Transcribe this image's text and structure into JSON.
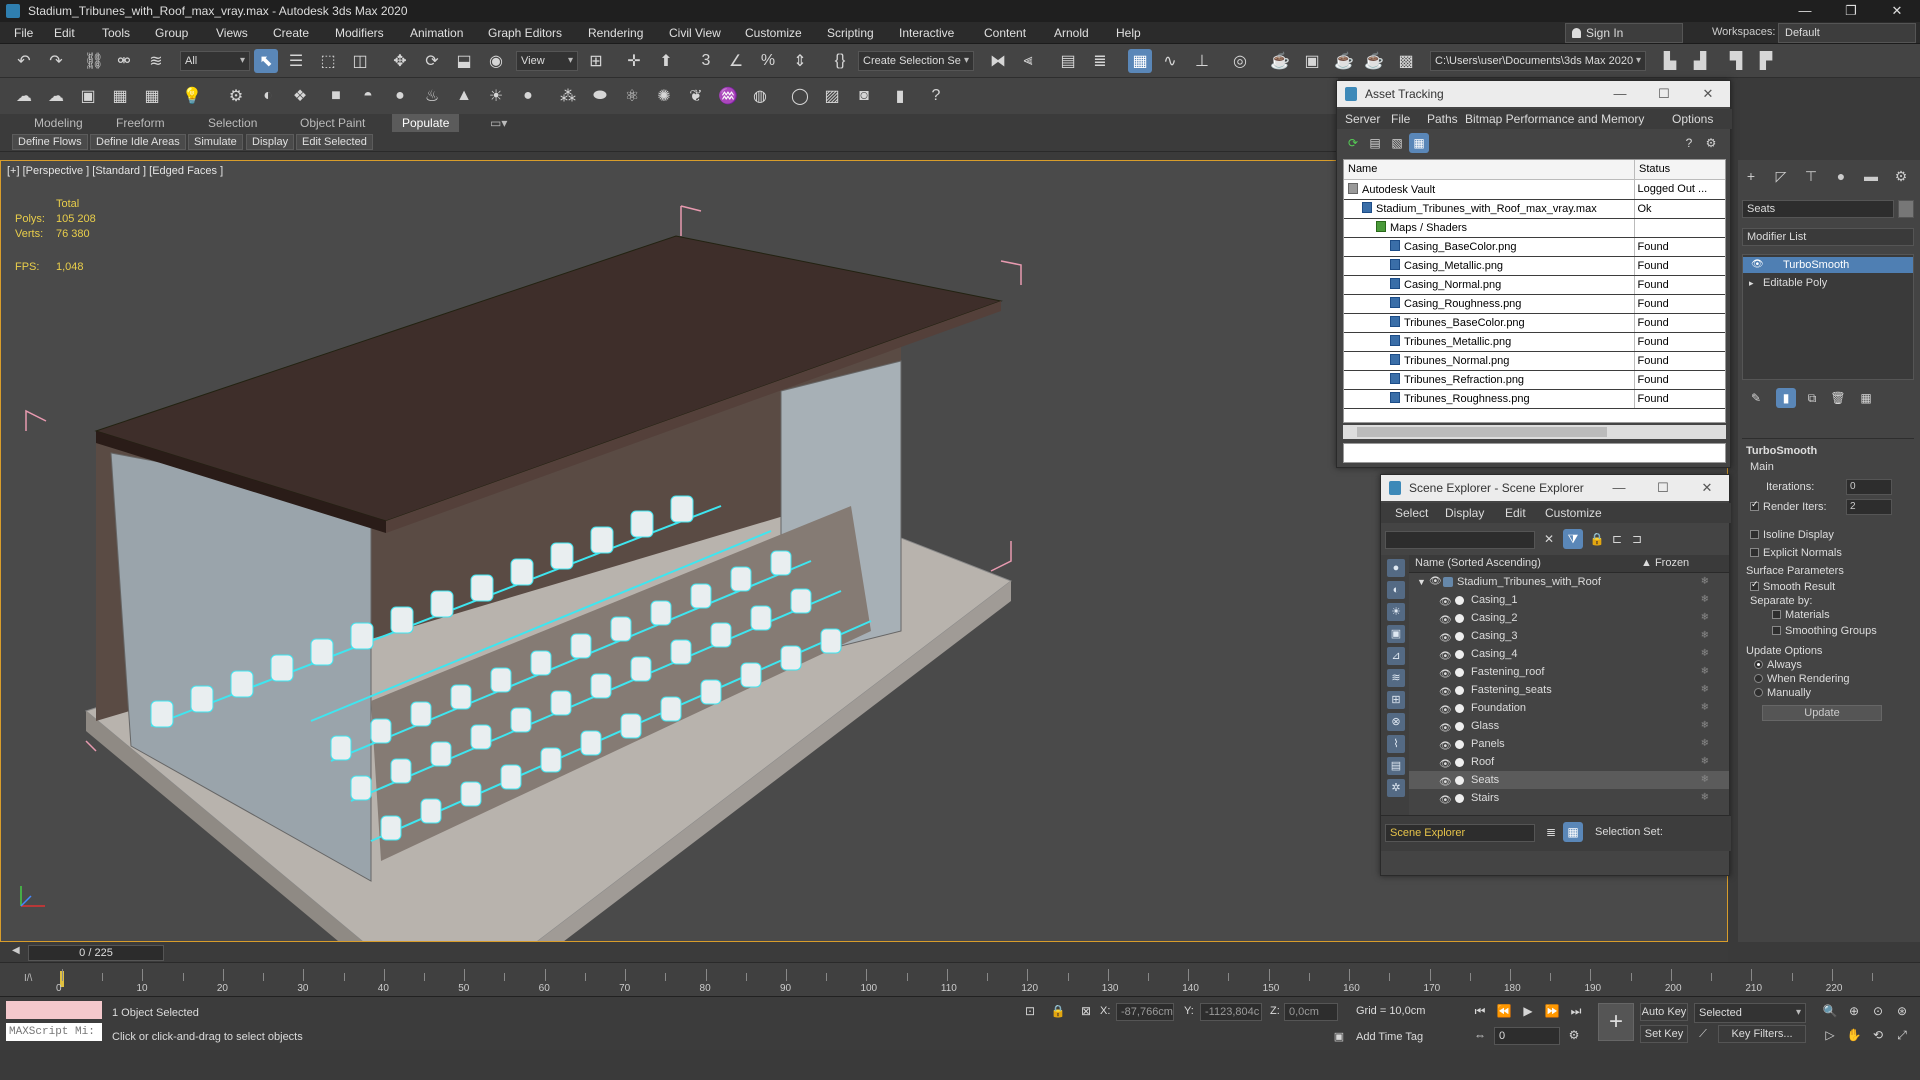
{
  "window": {
    "title": "Stadium_Tribunes_with_Roof_max_vray.max - Autodesk 3ds Max 2020",
    "minimize": "—",
    "maximize": "❐",
    "close": "✕"
  },
  "menubar": [
    "File",
    "Edit",
    "Tools",
    "Group",
    "Views",
    "Create",
    "Modifiers",
    "Animation",
    "Graph Editors",
    "Rendering",
    "Civil View",
    "Customize",
    "Scripting",
    "Interactive",
    "Content",
    "Arnold",
    "Help"
  ],
  "account": {
    "sign_in": "Sign In",
    "workspaces_label": "Workspaces:",
    "workspace": "Default"
  },
  "toolbar": {
    "selection_filter": "All",
    "ref_coord": "View",
    "named_selection": "Create Selection Se",
    "project_path": "C:\\Users\\user\\Documents\\3ds Max 2020"
  },
  "ribbon": {
    "tabs": [
      "Modeling",
      "Freeform",
      "Selection",
      "Object Paint",
      "Populate"
    ],
    "active_tab": "Populate",
    "populate_buttons": [
      "Define Flows",
      "Define Idle Areas",
      "Simulate",
      "Display",
      "Edit Selected"
    ]
  },
  "viewport": {
    "label": "[+] [Perspective ] [Standard ] [Edged Faces ]",
    "stats": {
      "total_label": "Total",
      "polys_label": "Polys:",
      "polys": "105 208",
      "verts_label": "Verts:",
      "verts": "76 380",
      "fps_label": "FPS:",
      "fps": "1,048"
    }
  },
  "asset_tracking": {
    "title": "Asset Tracking",
    "menu": [
      "Server",
      "File",
      "Paths",
      "Bitmap Performance and Memory",
      "Options"
    ],
    "columns": [
      "Name",
      "Status"
    ],
    "rows": [
      {
        "name": "Autodesk Vault",
        "status": "Logged Out ...",
        "indent": 0
      },
      {
        "name": "Stadium_Tribunes_with_Roof_max_vray.max",
        "status": "Ok",
        "indent": 1
      },
      {
        "name": "Maps / Shaders",
        "status": "",
        "indent": 2
      },
      {
        "name": "Casing_BaseColor.png",
        "status": "Found",
        "indent": 3
      },
      {
        "name": "Casing_Metallic.png",
        "status": "Found",
        "indent": 3
      },
      {
        "name": "Casing_Normal.png",
        "status": "Found",
        "indent": 3
      },
      {
        "name": "Casing_Roughness.png",
        "status": "Found",
        "indent": 3
      },
      {
        "name": "Tribunes_BaseColor.png",
        "status": "Found",
        "indent": 3
      },
      {
        "name": "Tribunes_Metallic.png",
        "status": "Found",
        "indent": 3
      },
      {
        "name": "Tribunes_Normal.png",
        "status": "Found",
        "indent": 3
      },
      {
        "name": "Tribunes_Refraction.png",
        "status": "Found",
        "indent": 3
      },
      {
        "name": "Tribunes_Roughness.png",
        "status": "Found",
        "indent": 3
      }
    ]
  },
  "scene_explorer": {
    "title": "Scene Explorer - Scene Explorer",
    "menu": [
      "Select",
      "Display",
      "Edit",
      "Customize"
    ],
    "col_name": "Name (Sorted Ascending)",
    "col_frozen": "▲ Frozen",
    "root": "Stadium_Tribunes_with_Roof",
    "objects": [
      "Casing_1",
      "Casing_2",
      "Casing_3",
      "Casing_4",
      "Fastening_roof",
      "Fastening_seats",
      "Foundation",
      "Glass",
      "Panels",
      "Roof",
      "Seats",
      "Stairs"
    ],
    "selected": "Seats",
    "footer_dropdown": "Scene Explorer",
    "selection_set_label": "Selection Set:"
  },
  "command_panel": {
    "object_name": "Seats",
    "modifier_list": "Modifier List",
    "stack": [
      "TurboSmooth",
      "Editable Poly"
    ],
    "rollout_title": "TurboSmooth",
    "main_label": "Main",
    "iterations_label": "Iterations:",
    "iterations": "0",
    "render_iters_label": "Render Iters:",
    "render_iters": "2",
    "isoline_display": "Isoline Display",
    "explicit_normals": "Explicit Normals",
    "surface_params": "Surface Parameters",
    "smooth_result": "Smooth Result",
    "separate_by": "Separate by:",
    "materials": "Materials",
    "smoothing_groups": "Smoothing Groups",
    "update_options": "Update Options",
    "always": "Always",
    "when_rendering": "When Rendering",
    "manually": "Manually",
    "update_button": "Update"
  },
  "timeline": {
    "frame": "0 / 225",
    "ticks": [
      "0",
      "10",
      "20",
      "30",
      "40",
      "50",
      "60",
      "70",
      "80",
      "90",
      "100",
      "110",
      "120",
      "130",
      "140",
      "150",
      "160",
      "170",
      "180",
      "190",
      "200",
      "210",
      "220"
    ]
  },
  "status": {
    "maxscript": "MAXScript Mi:",
    "selected_count": "1 Object Selected",
    "prompt": "Click or click-and-drag to select objects",
    "x_label": "X:",
    "x": "-87,766cm",
    "y_label": "Y:",
    "y": "-1123,804c",
    "z_label": "Z:",
    "z": "0,0cm",
    "grid": "Grid = 10,0cm",
    "add_time_tag": "Add Time Tag",
    "auto_key": "Auto Key",
    "set_key": "Set Key",
    "key_mode": "Selected",
    "key_filters": "Key Filters...",
    "frame_field": "0"
  }
}
